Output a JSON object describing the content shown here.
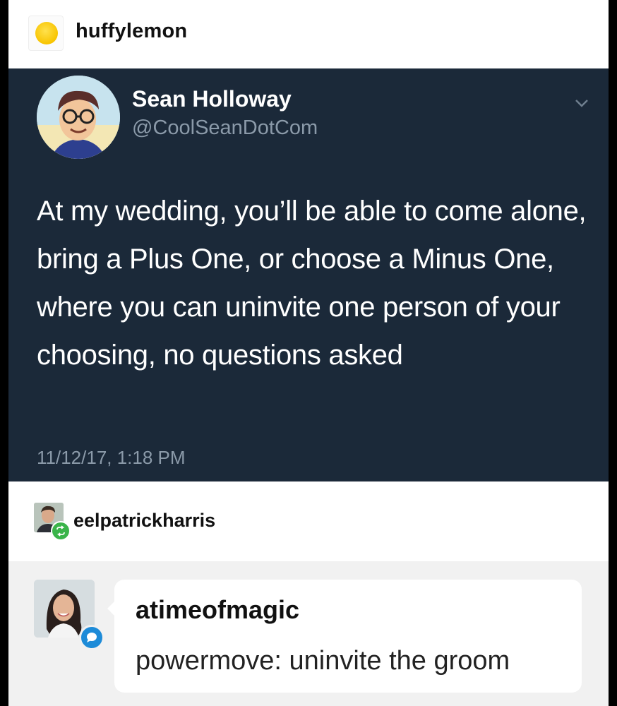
{
  "poster": {
    "username": "huffylemon",
    "avatar_icon": "yellow-circle-icon"
  },
  "tweet": {
    "author_name": "Sean Holloway",
    "author_handle": "@CoolSeanDotCom",
    "text": "At my wedding, you’ll be able to come alone, bring a Plus One, or choose a Minus One, where you can uninvite one person of your choosing, no questions asked",
    "timestamp": "11/12/17, 1:18 PM",
    "menu_icon": "chevron-down-icon",
    "background_color": "#1b2939"
  },
  "reblog": {
    "username": "eelpatrickharris",
    "badge_icon": "reblog-icon",
    "badge_color": "#3ab44a"
  },
  "comment": {
    "username": "atimeofmagic",
    "text": "powermove: uninvite the groom",
    "badge_icon": "chat-bubble-icon",
    "badge_color": "#1d8bd8"
  }
}
